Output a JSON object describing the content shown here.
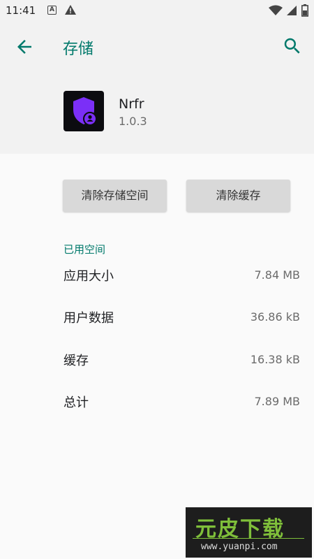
{
  "status_bar": {
    "time": "11:41",
    "icons": [
      "a-notification-icon",
      "warning-icon",
      "wifi-icon",
      "signal-icon",
      "battery-icon"
    ]
  },
  "header": {
    "title": "存储",
    "back_icon": "arrow-back-icon",
    "search_icon": "search-icon",
    "accent_color": "#00796b"
  },
  "app": {
    "name": "Nrfr",
    "version": "1.0.3",
    "icon": "purple-shield-user-icon",
    "icon_color": "#7b2ff7"
  },
  "actions": {
    "clear_storage": "清除存储空间",
    "clear_cache": "清除缓存"
  },
  "storage": {
    "section_label": "已用空间",
    "rows": [
      {
        "label": "应用大小",
        "value": "7.84 MB"
      },
      {
        "label": "用户数据",
        "value": "36.86 kB"
      },
      {
        "label": "缓存",
        "value": "16.38 kB"
      },
      {
        "label": "总计",
        "value": "7.89 MB"
      }
    ]
  },
  "watermark": {
    "main": "元皮下载",
    "url": "www.yuanpi.com"
  }
}
